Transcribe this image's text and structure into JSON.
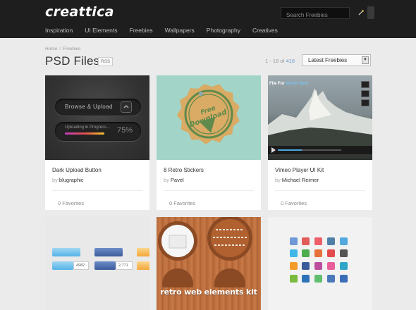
{
  "header": {
    "logo": "creattica",
    "search_placeholder": "Search Freebies",
    "nav": [
      "Inspiration",
      "UI Elements",
      "Freebies",
      "Wallpapers",
      "Photography",
      "Creatives"
    ]
  },
  "breadcrumb": {
    "home": "Home",
    "sep": "/",
    "current": "Freebies"
  },
  "page": {
    "title": "PSD Files",
    "rss": "RSS",
    "pager_prefix": "1 - 18 of",
    "pager_total": "416",
    "sort_selected": "Latest Freebies"
  },
  "cards": [
    {
      "title": "Dark Upload Button",
      "by": "by",
      "author": "blugraphic",
      "favorites": "0 Favorites",
      "thumb": {
        "button_label": "Browse & Upload",
        "progress_label": "Uploading in Progress...",
        "percent_text": "75%",
        "progress": 0.6
      }
    },
    {
      "title": "8 Retro Stickers",
      "by": "by",
      "author": "Pavel",
      "favorites": "0 Favorites",
      "thumb": {
        "sticker_line1": "Free",
        "sticker_line2": "Download"
      }
    },
    {
      "title": "Vimeo Player UI Kit",
      "by": "by",
      "author": "Michael Reimer",
      "favorites": "0 Favorites",
      "thumb": {
        "video_title_prefix": "File For",
        "video_title_highlight": "Movie Here"
      }
    },
    {
      "thumb": {
        "count_a": "4982",
        "count_b": "2,771"
      }
    },
    {
      "thumb": {
        "caption": "retro web elements kit"
      }
    },
    {
      "thumb": {}
    }
  ],
  "colors": {
    "header_bg": "#1e1e1e",
    "page_bg": "#ebebeb",
    "link_blue": "#6a9cc9",
    "sticker_bg": "#a3d4c8",
    "sticker_tan": "#d9ab64",
    "sticker_green": "#5f8a4b"
  }
}
